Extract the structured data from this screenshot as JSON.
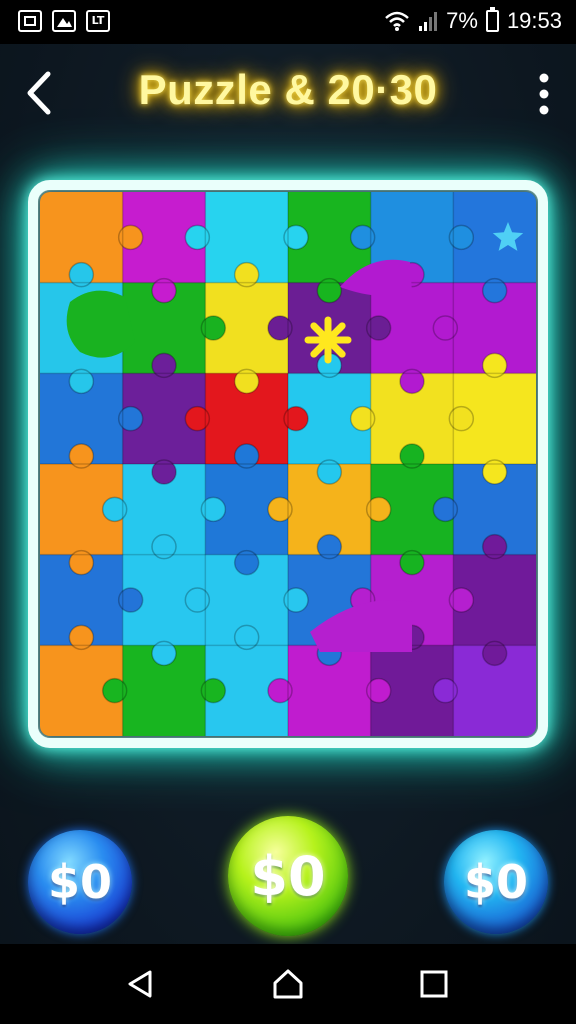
{
  "status_bar": {
    "notifications": [
      "screenshot-icon",
      "image-icon",
      "lt-icon"
    ],
    "lt_label": "LT",
    "battery_text": "7%",
    "time": "19:53"
  },
  "header": {
    "title": "Puzzle & 20·30",
    "back_icon": "chevron-left-icon",
    "menu_icon": "more-vertical-icon"
  },
  "board": {
    "rows": 6,
    "cols": 6,
    "frame_color": "#eafffb",
    "glow_color": "#2cd6c4",
    "pieces": [
      [
        "#f7941d",
        "#c61ccf",
        "#27d3ef",
        "#18b51f",
        "#1f8fe0",
        "#2376dc"
      ],
      [
        "#26c6ea",
        "#19b220",
        "#f1e01f",
        "#6b1e94",
        "#b21ad0",
        "#b21ad0"
      ],
      [
        "#2276d8",
        "#6c1f9a",
        "#e3171d",
        "#24c8ee",
        "#f2e11f",
        "#f5e61e"
      ],
      [
        "#f7941d",
        "#26c8ee",
        "#1f78d8",
        "#f5b31b",
        "#17b321",
        "#2373d8"
      ],
      [
        "#2374d8",
        "#28c7ef",
        "#28c7ef",
        "#2376d8",
        "#b51fcf",
        "#701a9a"
      ],
      [
        "#f7941d",
        "#18b520",
        "#28c7ef",
        "#c01ccf",
        "#701a98",
        "#8a2ad6"
      ]
    ]
  },
  "coins": {
    "left_label": "$0",
    "center_label": "$0",
    "right_label": "$0"
  },
  "nav": {
    "back": "triangle-back-icon",
    "home": "home-icon",
    "recents": "square-recents-icon"
  }
}
